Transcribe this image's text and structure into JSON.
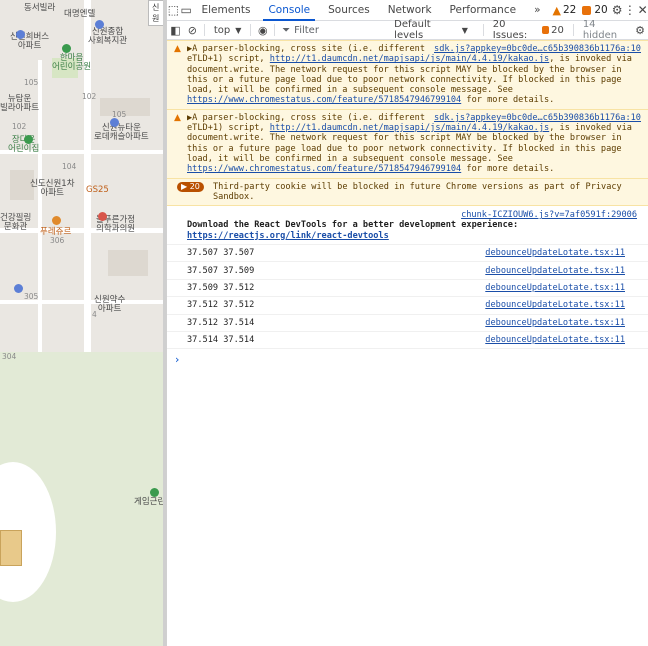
{
  "map": {
    "labels": {
      "l1": "동서빌라",
      "l2": "대명엔텔",
      "l3": "신원희버스\n아파트",
      "l4": "신원종합\n사회복지관",
      "l5": "한마음\n어린이공원",
      "l6": "뉴탐운\n빌라아파트",
      "l7": "신원뉴타운\n로데캐슬아파트",
      "l8": "장다운\n어린이집",
      "l9": "신도신원1차\n아파트",
      "l10": "GS25",
      "l11": "건강필링\n문화관",
      "l12": "푸레쥬르",
      "l13": "놀푸른가정\n의학과의원",
      "l14": "신원약수\n아파트",
      "l15": "게임근린",
      "pill": "신원"
    },
    "numbers": {
      "n105a": "105",
      "n105b": "105",
      "n102a": "102",
      "n102b": "102",
      "n104": "104",
      "n306": "306",
      "n305": "305",
      "n304": "304",
      "n4": "4"
    }
  },
  "devtools": {
    "tabs": [
      "Elements",
      "Console",
      "Sources",
      "Network",
      "Performance"
    ],
    "active_tab": "Console",
    "more": "»",
    "warnings_count": "22",
    "issues_count": "20",
    "toolbar": {
      "context": "top",
      "filter_placeholder": "Filter",
      "levels": "Default levels",
      "issues_label": "20 Issues:",
      "issues_num": "20",
      "hidden": "14 hidden"
    },
    "warnings": [
      {
        "src": "sdk.js?appkey=0bc0de…c65b390836b1176a:10",
        "line1": "▶A parser-blocking, cross site (i.e. different",
        "rest_pre": "eTLD+1) script, ",
        "link1": "http://t1.daumcdn.net/mapjsapi/js/main/4.4.19/kakao.js",
        "rest_mid": ", is invoked via document.write. The network request for this script MAY be blocked by the browser in this or a future page load due to poor network connectivity. If blocked in this page load, it will be confirmed in a subsequent console message. See ",
        "link2": "https://www.chromestatus.com/feature/5718547946799104",
        "rest_end": " for more details."
      },
      {
        "src": "sdk.js?appkey=0bc0de…c65b390836b1176a:10",
        "line1": "▶A parser-blocking, cross site (i.e. different",
        "rest_pre": "eTLD+1) script, ",
        "link1": "http://t1.daumcdn.net/mapjsapi/js/main/4.4.19/kakao.js",
        "rest_mid": ", is invoked via document.write. The network request for this script MAY be blocked by the browser in this or a future page load due to poor network connectivity. If blocked in this page load, it will be confirmed in a subsequent console message. See ",
        "link2": "https://www.chromestatus.com/feature/5718547946799104",
        "rest_end": " for more details."
      }
    ],
    "cookie_group": {
      "count": "20",
      "text": "Third-party cookie will be blocked in future Chrome versions as part of Privacy Sandbox."
    },
    "devtools_msg": {
      "src": "chunk-ICZIOUW6.js?v=7af0591f:29006",
      "text": "Download the React DevTools for a better development experience: ",
      "link": "https://reactjs.org/link/react-devtools"
    },
    "logs": [
      {
        "text": "37.507 37.507",
        "src": "debounceUpdateLotate.tsx:11"
      },
      {
        "text": "37.507 37.509",
        "src": "debounceUpdateLotate.tsx:11"
      },
      {
        "text": "37.509 37.512",
        "src": "debounceUpdateLotate.tsx:11"
      },
      {
        "text": "37.512 37.512",
        "src": "debounceUpdateLotate.tsx:11"
      },
      {
        "text": "37.512 37.514",
        "src": "debounceUpdateLotate.tsx:11"
      },
      {
        "text": "37.514 37.514",
        "src": "debounceUpdateLotate.tsx:11"
      }
    ],
    "prompt": "›"
  }
}
